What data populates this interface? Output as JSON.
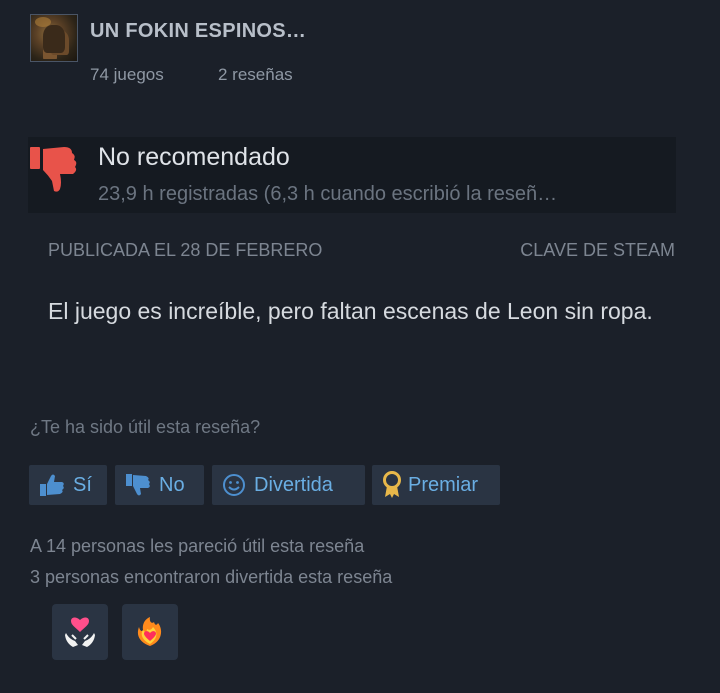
{
  "profile": {
    "username": "UN FOKIN ESPINOS…",
    "games": "74 juegos",
    "reviews": "2 reseñas"
  },
  "review": {
    "verdict": "No recomendado",
    "verdict_icon": "thumbs-down-icon",
    "hours": "23,9 h registradas (6,3 h cuando escribió la reseñ…",
    "posted": "PUBLICADA EL 28 DE FEBRERO",
    "product_source": "CLAVE DE STEAM",
    "body": "El juego es increíble, pero faltan escenas de Leon sin ropa."
  },
  "feedback": {
    "question": "¿Te ha sido útil esta reseña?",
    "buttons": {
      "yes": "Sí",
      "no": "No",
      "funny": "Divertida",
      "award": "Premiar"
    },
    "helpful_count_text": "A 14 personas les pareció útil esta reseña",
    "funny_count_text": "3 personas encontraron divertida esta reseña"
  },
  "awards": [
    {
      "name": "heart-hands-award-icon"
    },
    {
      "name": "fire-heart-award-icon"
    }
  ],
  "colors": {
    "background": "#1b2029",
    "accent_blue": "#6aaee3",
    "thumbs_down": "#e8534a",
    "button_bg": "#2a3443"
  }
}
